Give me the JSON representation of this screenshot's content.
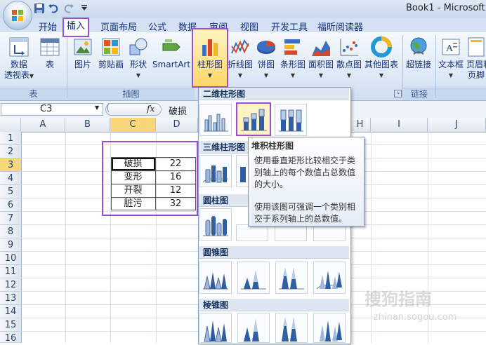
{
  "title_bar": {
    "title": "Book1 - Microsoft E"
  },
  "quick_access": {
    "icons": [
      "save-icon",
      "undo-icon",
      "redo-icon",
      "qat-menu-icon"
    ]
  },
  "tabs": [
    "开始",
    "插入",
    "页面布局",
    "公式",
    "数据",
    "审阅",
    "视图",
    "开发工具",
    "福昕阅读器"
  ],
  "ribbon": {
    "pivot_label": "数据",
    "pivot_label2": "透视表",
    "table_label": "表",
    "picture_label": "图片",
    "clipart_label": "剪贴画",
    "shapes_label": "形状",
    "smartart_label": "SmartArt",
    "column_chart_label": "柱形图",
    "line_chart_label": "折线图",
    "pie_chart_label": "饼图",
    "bar_chart_label": "条形图",
    "area_chart_label": "面积图",
    "scatter_chart_label": "散点图",
    "other_chart_label": "其他图表",
    "hyperlink_label": "超链接",
    "textbox_label": "文本框",
    "header_label": "页眉和",
    "header_label2": "页脚",
    "groups": {
      "table": "表",
      "illustrations": "插图",
      "links": "链接"
    }
  },
  "formula_bar": {
    "name_box": "C3",
    "fx": "fx",
    "content": "破损"
  },
  "sheet": {
    "columns": [
      "A",
      "B",
      "C",
      "D",
      "E",
      "F",
      "G",
      "H",
      "I",
      "J"
    ],
    "rows": [
      "1",
      "2",
      "3",
      "4",
      "5",
      "6",
      "7",
      "8",
      "9",
      "10",
      "11",
      "12",
      "13",
      "14",
      "15",
      "16"
    ],
    "table": [
      {
        "label": "破损",
        "value": "22"
      },
      {
        "label": "变形",
        "value": "16"
      },
      {
        "label": "开裂",
        "value": "12"
      },
      {
        "label": "脏污",
        "value": "32"
      }
    ]
  },
  "gallery": {
    "sections": [
      "二维柱形图",
      "三维柱形图",
      "圆柱图",
      "圆锥图",
      "棱锥图"
    ]
  },
  "tooltip": {
    "title": "堆积柱形图",
    "lines": [
      "使用垂直矩形比较相交于类",
      "别轴上的每个数值占总数值",
      "的大小。",
      "",
      "使用该图可强调一个类别相",
      "交于系列轴上的总数值。"
    ]
  },
  "watermark": {
    "text": "搜狗指南",
    "url": "zhinan.sogou.com"
  },
  "colors": {
    "accent": "#9b4fd0",
    "ribbon": "#dbe7f5",
    "tab_text": "#15307a"
  }
}
